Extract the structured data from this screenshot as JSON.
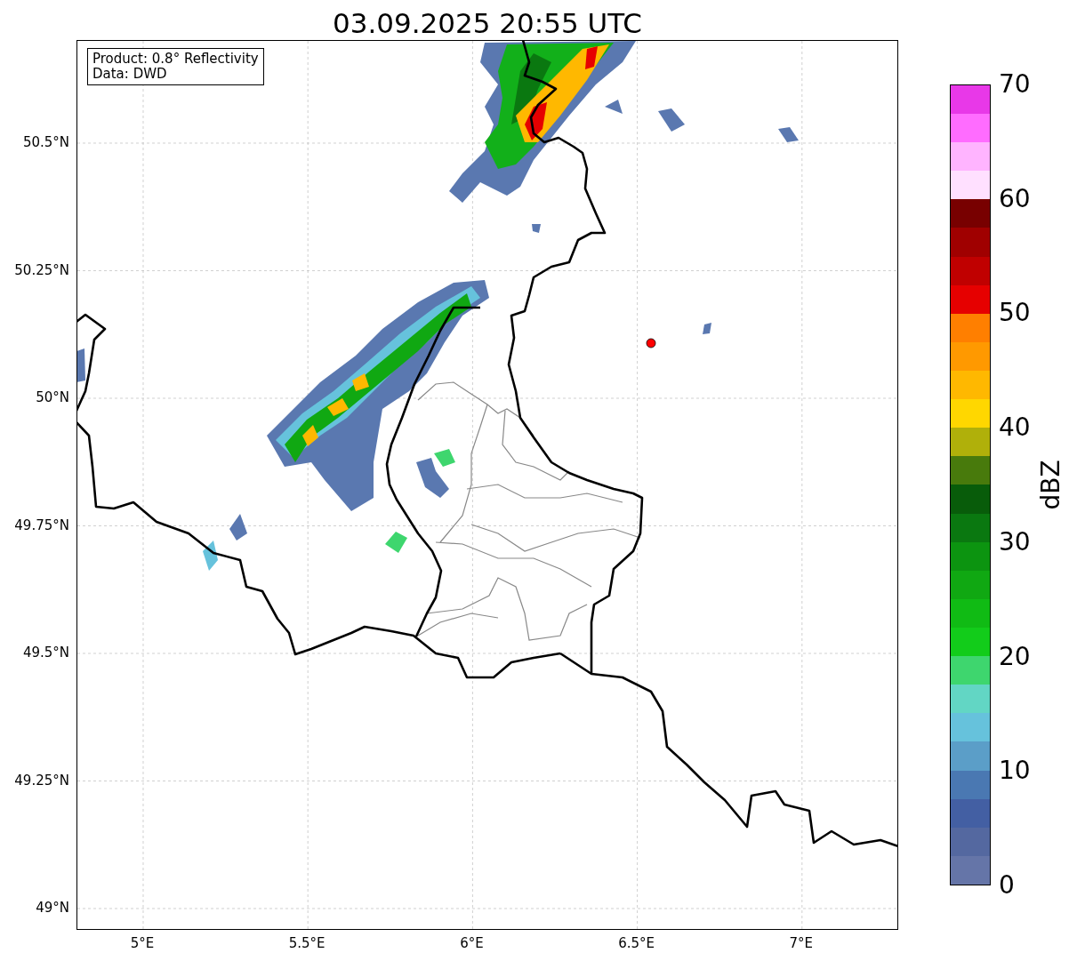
{
  "title": "03.09.2025 20:55 UTC",
  "info_box": {
    "lines": [
      "Product: 0.8° Reflectivity",
      "Data: DWD"
    ]
  },
  "lat_ticks": [
    "50.5°N",
    "50.25°N",
    "50°N",
    "49.75°N",
    "49.5°N",
    "49.25°N",
    "49°N"
  ],
  "lon_ticks": [
    "5°E",
    "5.5°E",
    "6°E",
    "6.5°E",
    "7°E"
  ],
  "colorbar": {
    "label": "dBZ",
    "ticks": [
      "70",
      "60",
      "50",
      "40",
      "30",
      "20",
      "10",
      "0"
    ],
    "bands": [
      {
        "color": "#6575a8"
      },
      {
        "color": "#5468a0"
      },
      {
        "color": "#435fa3"
      },
      {
        "color": "#4a78b2"
      },
      {
        "color": "#5b9ec8"
      },
      {
        "color": "#66c2dc"
      },
      {
        "color": "#62d6c4"
      },
      {
        "color": "#3ed66e"
      },
      {
        "color": "#12cc1a"
      },
      {
        "color": "#10bb14"
      },
      {
        "color": "#10a812"
      },
      {
        "color": "#0c9410"
      },
      {
        "color": "#0a7810"
      },
      {
        "color": "#085c0a"
      },
      {
        "color": "#487a0c"
      },
      {
        "color": "#b0b00a"
      },
      {
        "color": "#ffd700"
      },
      {
        "color": "#ffb800"
      },
      {
        "color": "#ff9900"
      },
      {
        "color": "#ff7f00"
      },
      {
        "color": "#e60000"
      },
      {
        "color": "#c00000"
      },
      {
        "color": "#a00000"
      },
      {
        "color": "#780000"
      },
      {
        "color": "#ffe0ff"
      },
      {
        "color": "#ffb4ff"
      },
      {
        "color": "#ff6cff"
      },
      {
        "color": "#e838e8"
      }
    ]
  }
}
